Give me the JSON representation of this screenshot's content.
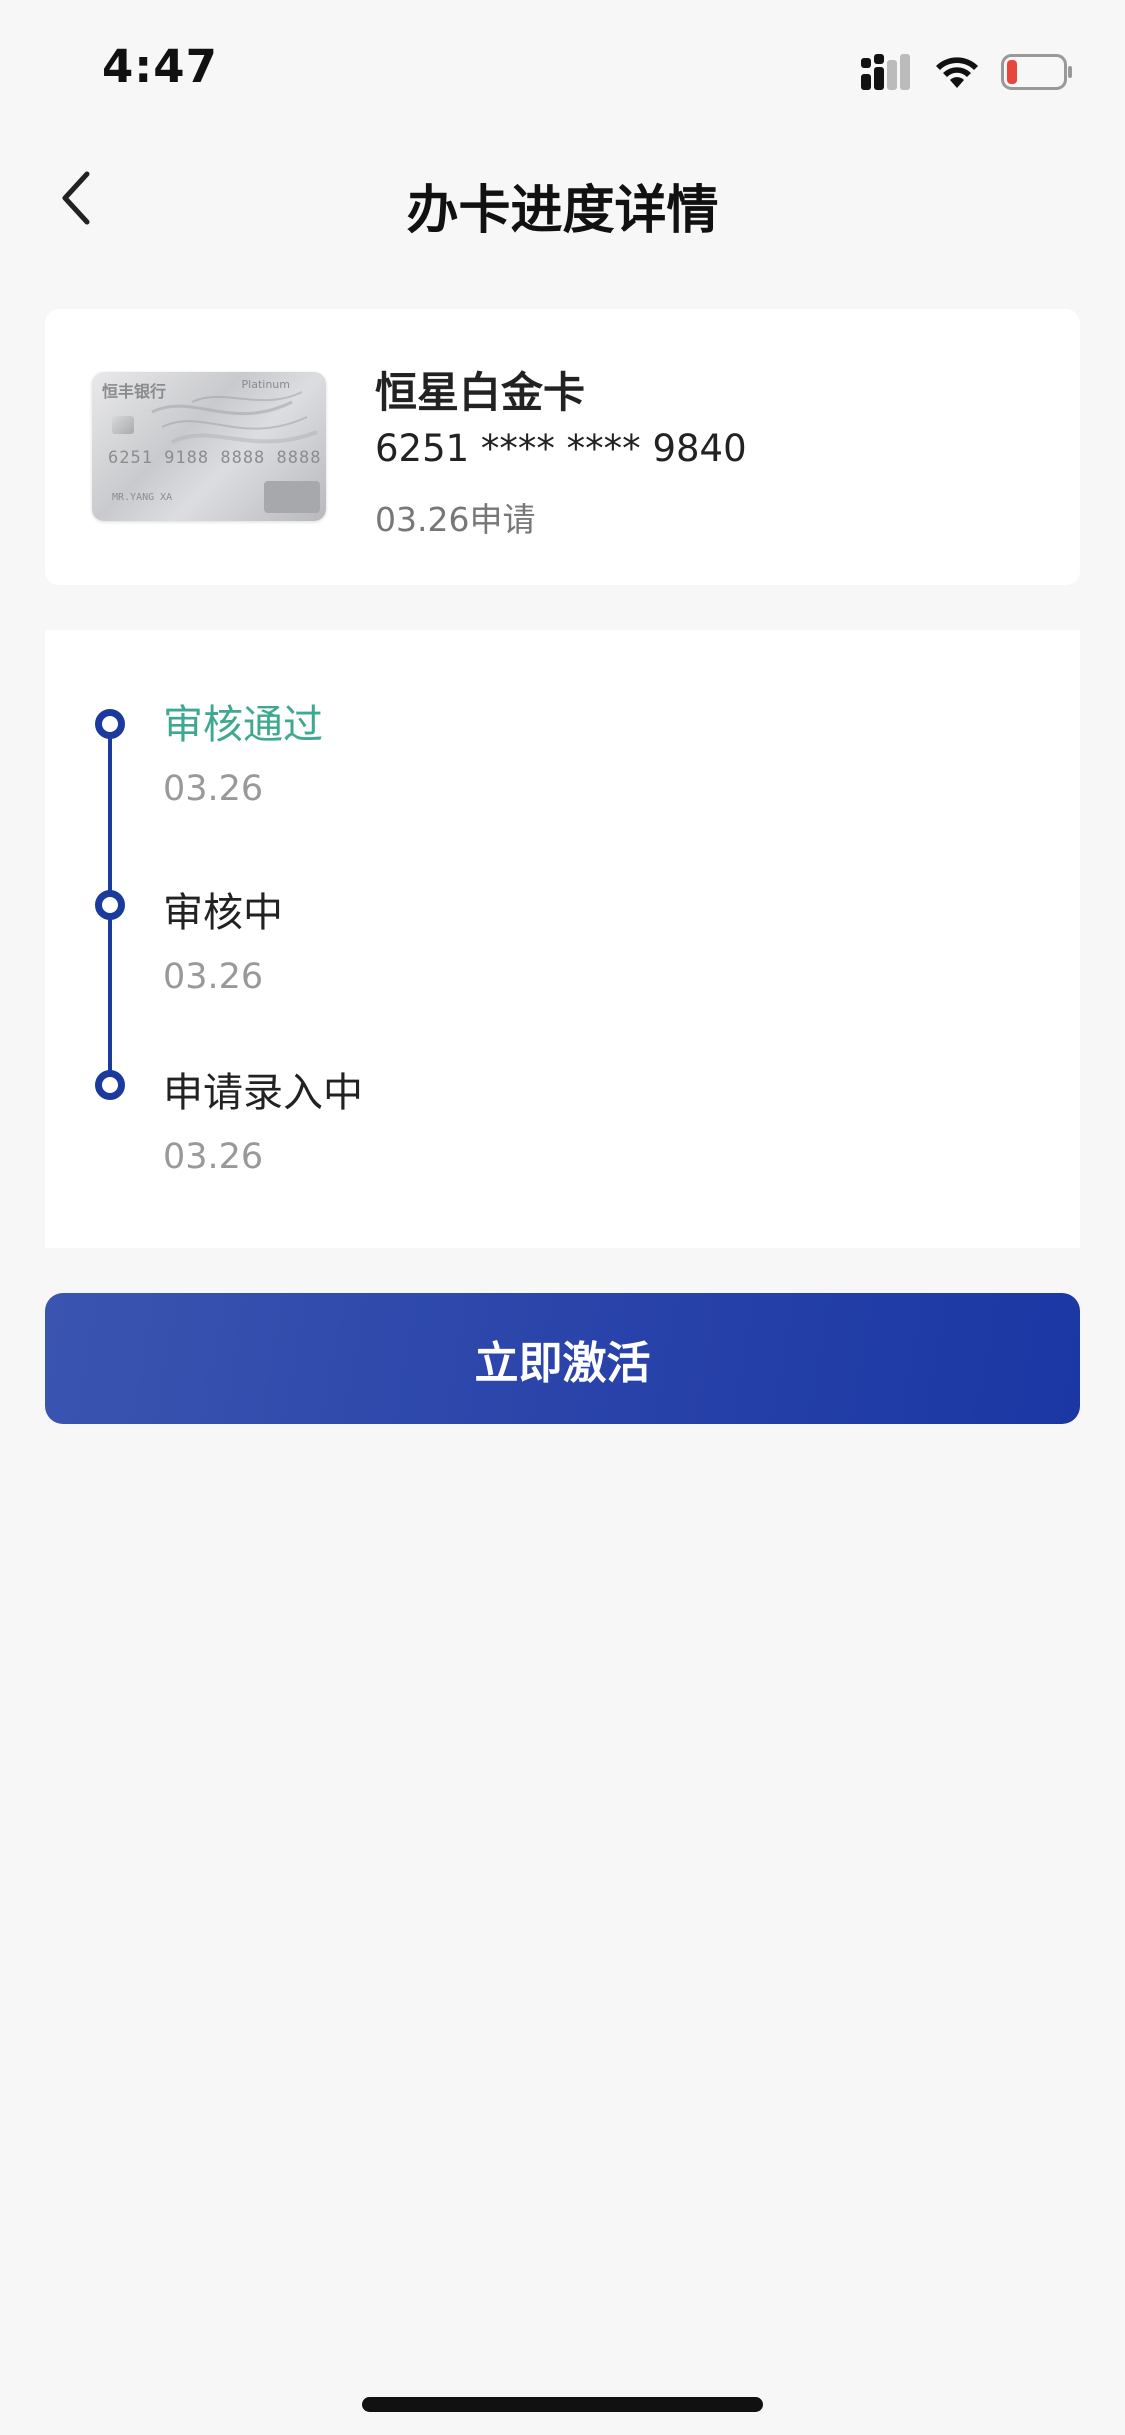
{
  "status_bar": {
    "time": "4:47"
  },
  "nav": {
    "title": "办卡进度详情",
    "back_icon": "chevron-left-icon"
  },
  "card": {
    "name": "恒星白金卡",
    "number": "6251 **** **** 9840",
    "apply_date": "03.26申请",
    "image": {
      "bank_name": "恒丰银行",
      "tier": "Platinum",
      "digits": "6251 9188 8888 8888",
      "holder": "MR.YANG XA"
    }
  },
  "progress": {
    "steps": [
      {
        "label": "审核通过",
        "date": "03.26",
        "status": "done"
      },
      {
        "label": "审核中",
        "date": "03.26",
        "status": "normal"
      },
      {
        "label": "申请录入中",
        "date": "03.26",
        "status": "normal"
      }
    ]
  },
  "actions": {
    "activate_label": "立即激活"
  },
  "colors": {
    "accent": "#1b3a9e",
    "done_text": "#3fa890",
    "background": "#f7f7f8"
  }
}
